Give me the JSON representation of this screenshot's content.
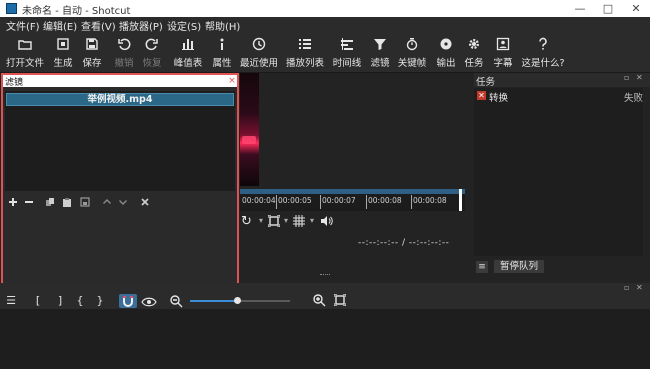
{
  "window": {
    "title": "未命名 - 自动 - Shotcut",
    "min_label": "—",
    "max_label": "□",
    "close_label": "✕"
  },
  "menu": [
    "文件(F)",
    "编辑(E)",
    "查看(V)",
    "播放器(P)",
    "设定(S)",
    "帮助(H)"
  ],
  "toolbar": [
    {
      "label": "打开文件",
      "icon": "open-folder-icon"
    },
    {
      "label": "生成",
      "icon": "generate-icon"
    },
    {
      "label": "保存",
      "icon": "save-icon"
    },
    {
      "label": "撤销",
      "icon": "undo-icon",
      "disabled": true
    },
    {
      "label": "恢复",
      "icon": "redo-icon",
      "disabled": true
    },
    {
      "label": "峰值表",
      "icon": "peak-meter-icon"
    },
    {
      "label": "属性",
      "icon": "properties-icon"
    },
    {
      "label": "最近使用",
      "icon": "clock-icon"
    },
    {
      "label": "播放列表",
      "icon": "playlist-icon"
    },
    {
      "label": "时间线",
      "icon": "timeline-icon"
    },
    {
      "label": "滤镜",
      "icon": "filter-icon"
    },
    {
      "label": "关键帧",
      "icon": "keyframe-icon"
    },
    {
      "label": "输出",
      "icon": "export-icon"
    },
    {
      "label": "任务",
      "icon": "gear-icon"
    },
    {
      "label": "字幕",
      "icon": "subtitle-icon"
    },
    {
      "label": "这是什么?",
      "icon": "help-icon"
    }
  ],
  "filters": {
    "title": "滤镜",
    "close": "×",
    "clip_name": "举例视频.mp4",
    "buttons": [
      "add-icon",
      "remove-icon",
      "copy-icon",
      "paste-icon",
      "save-preset-icon",
      "move-up-icon",
      "move-down-icon",
      "deselect-icon"
    ]
  },
  "player": {
    "ticks": [
      "00:00:04",
      "00:00:05",
      "00:00:07",
      "00:00:08",
      "00:00:08"
    ],
    "timecode": "--:--:--:-- / --:--:--:--"
  },
  "jobs": {
    "title": "任务",
    "items": [
      {
        "name": "转换",
        "status": "失败"
      }
    ],
    "menu_label": "≡",
    "pause_label": "暂停队列"
  },
  "timeline": {
    "tools": [
      "menu-icon",
      "in-bracket-icon",
      "out-bracket-icon",
      "brace-left-icon",
      "brace-right-icon",
      "snap-magnet-icon",
      "scrub-eye-icon",
      "zoom-out-icon",
      "zoom-in-icon",
      "zoom-fit-icon"
    ],
    "zoom_level": 0.45
  },
  "colors": {
    "accent": "#2b6786",
    "highlight_border": "#e05353",
    "error": "#c0392b"
  }
}
